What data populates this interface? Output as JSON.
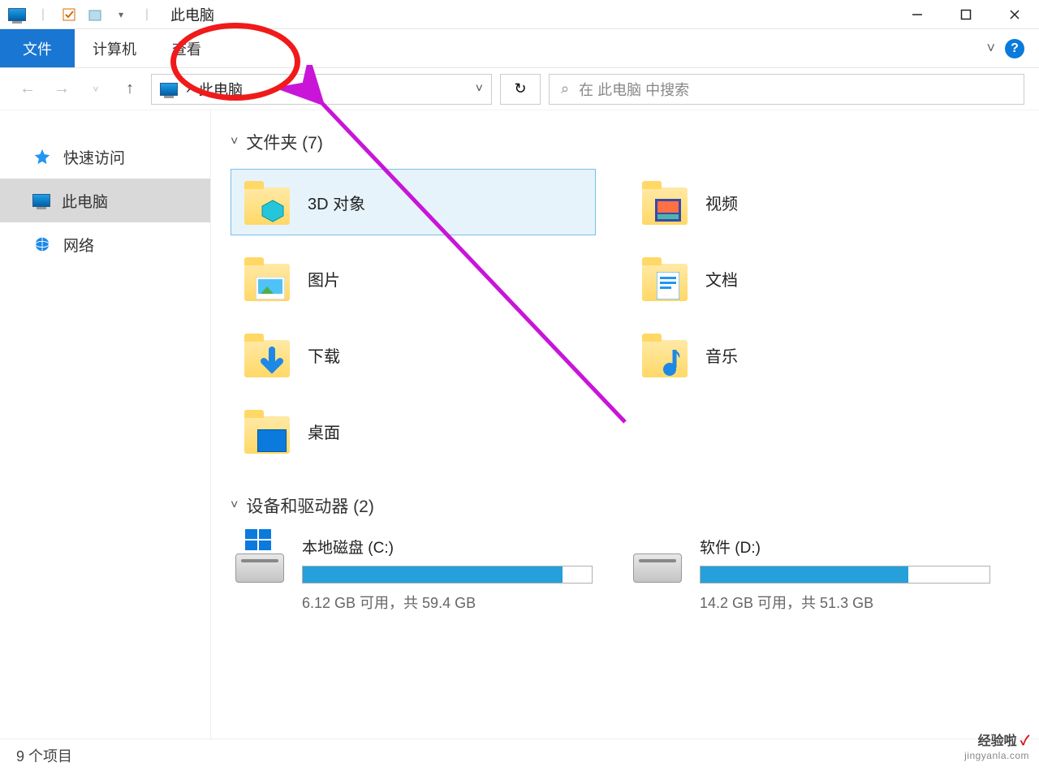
{
  "titlebar": {
    "title": "此电脑"
  },
  "ribbon": {
    "tabs": {
      "file": "文件",
      "computer": "计算机",
      "view": "查看"
    },
    "expand_hint": "˅"
  },
  "addressbar": {
    "sep": "›",
    "location": "此电脑",
    "search_placeholder": "在 此电脑 中搜索"
  },
  "sidebar": {
    "quick_access": "快速访问",
    "this_pc": "此电脑",
    "network": "网络"
  },
  "groups": {
    "folders_header": "文件夹 (7)",
    "drives_header": "设备和驱动器 (2)"
  },
  "folders": {
    "objects3d": "3D 对象",
    "videos": "视频",
    "pictures": "图片",
    "documents": "文档",
    "downloads": "下载",
    "music": "音乐",
    "desktop": "桌面"
  },
  "drives": {
    "c": {
      "name": "本地磁盘 (C:)",
      "status": "6.12 GB 可用，共 59.4 GB",
      "fill_pct": 90
    },
    "d": {
      "name": "软件 (D:)",
      "status": "14.2 GB 可用，共 51.3 GB",
      "fill_pct": 72
    }
  },
  "statusbar": {
    "count": "9 个项目"
  },
  "watermark": {
    "line1_a": "经验啦",
    "line1_b": "✓",
    "line2": "jingyanla.com"
  }
}
